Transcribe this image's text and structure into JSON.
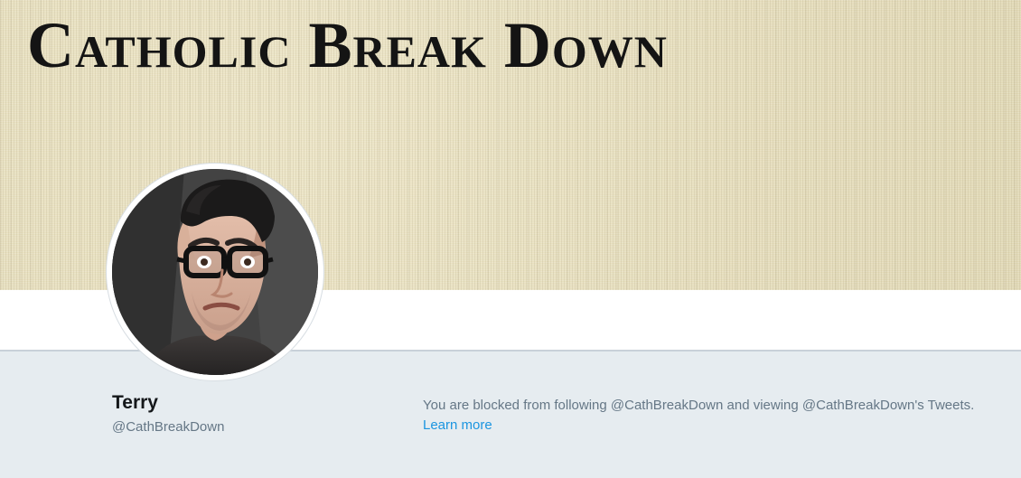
{
  "banner": {
    "title": "Catholic Break Down",
    "colors": {
      "background": "#e8dfba",
      "text": "#141414"
    }
  },
  "profile": {
    "name": "Terry",
    "handle": "@CathBreakDown",
    "avatar": {
      "icon": "profile-photo"
    }
  },
  "blocked_notice": {
    "message": "You are blocked from following @CathBreakDown and viewing @CathBreakDown's Tweets.",
    "learn_more_label": "Learn more"
  },
  "colors": {
    "page_background": "#e6ecf0",
    "link": "#1b95e0",
    "secondary_text": "#657786",
    "primary_text": "#14171a"
  }
}
